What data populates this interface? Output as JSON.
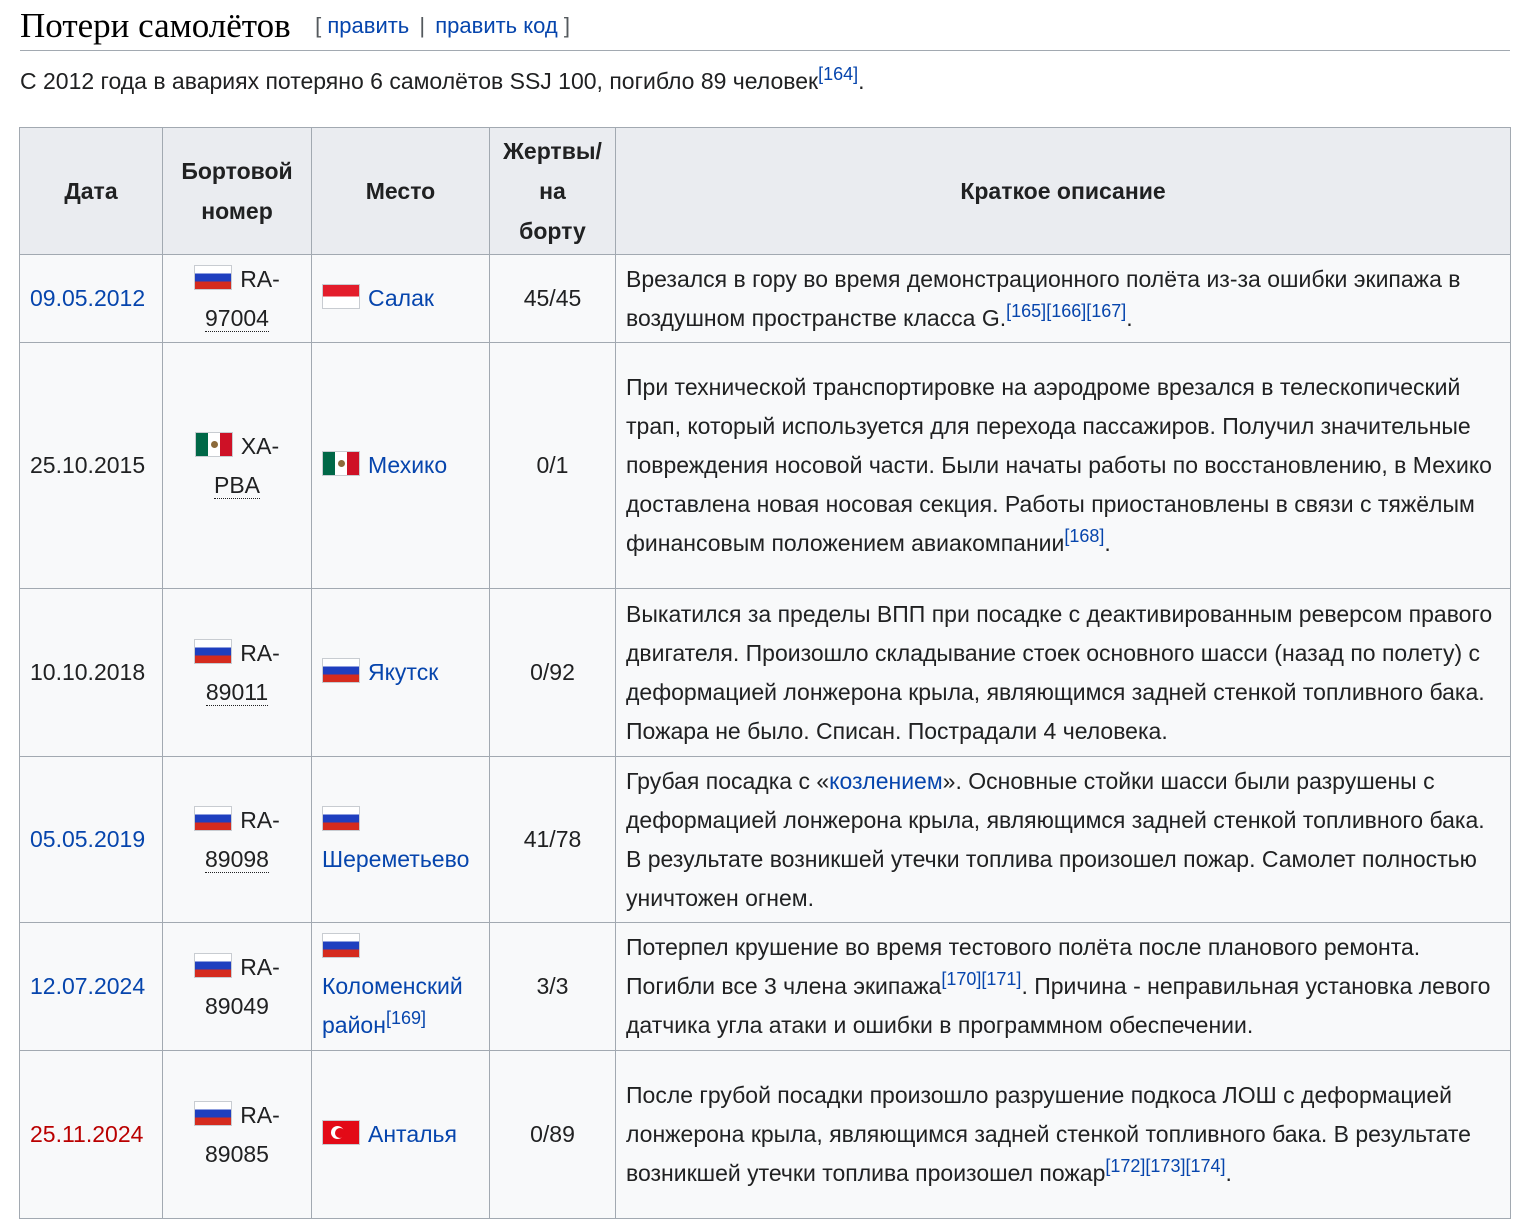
{
  "section": {
    "title": "Потери самолётов",
    "edit_open": "[",
    "edit_label": "править",
    "edit_separator": "|",
    "edit_code_label": "править код",
    "edit_close": "]"
  },
  "intro": {
    "text": "С 2012 года в авариях потеряно 6 самолётов SSJ 100, погибло 89 человек",
    "ref": "[164]",
    "end": "."
  },
  "table": {
    "headers": {
      "date": "Дата",
      "board_line1": "Бортовой",
      "board_line2": "номер",
      "place": "Место",
      "victims_line1": "Жертвы/",
      "victims_line2": "на",
      "victims_line3": "борту",
      "desc": "Краткое описание"
    },
    "rows": [
      {
        "date": "09.05.2012",
        "flag": "russia-flag",
        "board_1": "RA-",
        "board_2": "97004",
        "place_flag": "indonesia-flag",
        "place": "Салак",
        "victims": "45/45",
        "desc": "Врезался в гору во время демонстрационного полёта из-за ошибки экипажа в воздушном пространстве класса G.",
        "refs": [
          "[165]",
          "[166]",
          "[167]"
        ],
        "desc_end": "."
      },
      {
        "date": "25.10.2015",
        "flag": "mexico-flag",
        "board_1": "XA-",
        "board_2": "PBA",
        "place_flag": "mexico-flag",
        "place": "Мехико",
        "victims": "0/1",
        "desc": "При технической транспортировке на аэродроме врезался в телескопический трап, который используется для перехода пассажиров. Получил значительные повреждения носовой части. Были начаты работы по восстановлению, в Мехико доставлена новая носовая секция. Работы приостановлены в связи с тяжёлым финансовым положением авиакомпании",
        "refs": [
          "[168]"
        ],
        "desc_end": "."
      },
      {
        "date": "10.10.2018",
        "flag": "russia-flag",
        "board_1": "RA-",
        "board_2": "89011",
        "place_flag": "russia-flag",
        "place": "Якутск",
        "victims": "0/92",
        "desc": "Выкатился за пределы ВПП при посадке с деактивированным реверсом правого двигателя. Произошло складывание стоек основного шасси (назад по полету) с деформацией лонжерона крыла, являющимся задней стенкой топливного бака. Пожара не было. Списан. Пострадали 4 человека."
      },
      {
        "date": "05.05.2019",
        "flag": "russia-flag",
        "board_1": "RA-",
        "board_2": "89098",
        "place_flag": "russia-flag",
        "place": "Шереметьево",
        "victims": "41/78",
        "desc_pre": "Грубая посадка с «",
        "desc_link": "козлением",
        "desc_post": "». Основные стойки шасси были разрушены с деформацией лонжерона крыла, являющимся задней стенкой топливного бака. В результате возникшей утечки топлива произошел пожар. Самолет полностью уничтожен огнем."
      },
      {
        "date": "12.07.2024",
        "flag": "russia-flag",
        "board_1": "RA-",
        "board_2": "89049",
        "place_flag": "russia-flag",
        "place": "Коломенский район",
        "place_ref": "[169]",
        "victims": "3/3",
        "desc_pre": "Потерпел крушение во время тестового полёта после планового ремонта. Погибли все 3 члена экипажа",
        "refs": [
          "[170]",
          "[171]"
        ],
        "desc_post": ". Причина - неправильная установка левого датчика угла атаки и ошибки в программном обеспечении."
      },
      {
        "date": "25.11.2024",
        "flag": "russia-flag",
        "board_1": "RA-",
        "board_2": "89085",
        "place_flag": "turkey-flag",
        "place": "Анталья",
        "victims": "0/89",
        "desc": "После грубой посадки произошло разрушение подкоса ЛОШ с деформацией лонжерона крыла, являющимся задней стенкой топливного бака. В результате возникшей утечки топлива произошел пожар",
        "refs": [
          "[172]",
          "[173]",
          "[174]"
        ],
        "desc_end": "."
      }
    ]
  },
  "colors": {
    "link": "#0645ad",
    "redlink": "#ba0000",
    "header_bg": "#eaecf0",
    "cell_bg": "#f8f9fa",
    "border": "#a2a9b1"
  }
}
